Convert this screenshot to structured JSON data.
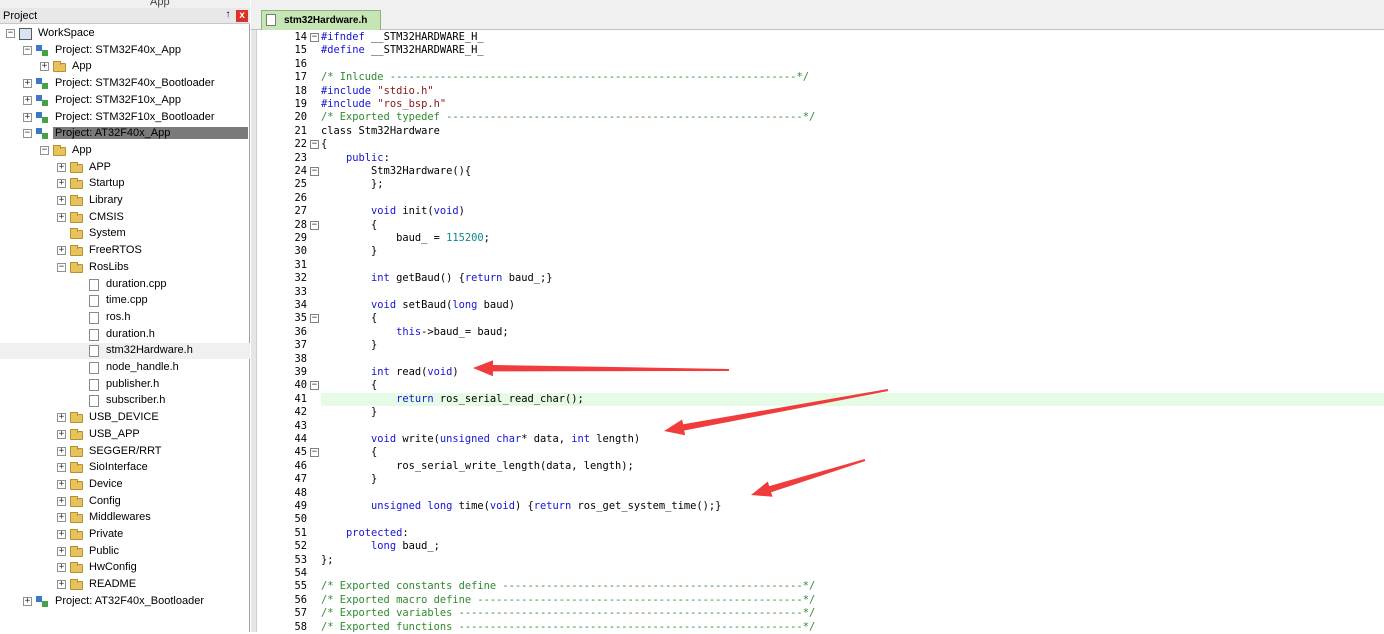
{
  "panel": {
    "title": "Project",
    "toolbar_text": "App",
    "pin_glyph": "↑",
    "close_glyph": "x"
  },
  "tree": [
    {
      "label": "WorkSpace",
      "level": 0,
      "icon": "workspace-icon",
      "exp": "-"
    },
    {
      "label": "Project: STM32F40x_App",
      "level": 1,
      "icon": "project-icon",
      "exp": "-"
    },
    {
      "label": "App",
      "level": 2,
      "icon": "folder-icon",
      "exp": "+"
    },
    {
      "label": "Project: STM32F40x_Bootloader",
      "level": 1,
      "icon": "project-icon",
      "exp": "+"
    },
    {
      "label": "Project: STM32F10x_App",
      "level": 1,
      "icon": "project-icon",
      "exp": "+"
    },
    {
      "label": "Project: STM32F10x_Bootloader",
      "level": 1,
      "icon": "project-icon",
      "exp": "+"
    },
    {
      "label": "Project: AT32F40x_App",
      "level": 1,
      "icon": "project-icon",
      "exp": "-",
      "selected": true
    },
    {
      "label": "App",
      "level": 2,
      "icon": "folder-icon",
      "exp": "-"
    },
    {
      "label": "APP",
      "level": 3,
      "icon": "folder-icon",
      "exp": "+"
    },
    {
      "label": "Startup",
      "level": 3,
      "icon": "folder-icon",
      "exp": "+"
    },
    {
      "label": "Library",
      "level": 3,
      "icon": "folder-icon",
      "exp": "+"
    },
    {
      "label": "CMSIS",
      "level": 3,
      "icon": "folder-icon",
      "exp": "+"
    },
    {
      "label": "System",
      "level": 3,
      "icon": "folder-icon",
      "exp": ""
    },
    {
      "label": "FreeRTOS",
      "level": 3,
      "icon": "folder-icon",
      "exp": "+"
    },
    {
      "label": "RosLibs",
      "level": 3,
      "icon": "folder-icon",
      "exp": "-"
    },
    {
      "label": "duration.cpp",
      "level": 4,
      "icon": "file-icon",
      "exp": ""
    },
    {
      "label": "time.cpp",
      "level": 4,
      "icon": "file-icon",
      "exp": ""
    },
    {
      "label": "ros.h",
      "level": 4,
      "icon": "file-icon",
      "exp": ""
    },
    {
      "label": "duration.h",
      "level": 4,
      "icon": "file-icon",
      "exp": ""
    },
    {
      "label": "stm32Hardware.h",
      "level": 4,
      "icon": "file-icon",
      "exp": "",
      "hover": true
    },
    {
      "label": "node_handle.h",
      "level": 4,
      "icon": "file-icon",
      "exp": ""
    },
    {
      "label": "publisher.h",
      "level": 4,
      "icon": "file-icon",
      "exp": ""
    },
    {
      "label": "subscriber.h",
      "level": 4,
      "icon": "file-icon",
      "exp": ""
    },
    {
      "label": "USB_DEVICE",
      "level": 3,
      "icon": "folder-icon",
      "exp": "+"
    },
    {
      "label": "USB_APP",
      "level": 3,
      "icon": "folder-icon",
      "exp": "+"
    },
    {
      "label": "SEGGER/RRT",
      "level": 3,
      "icon": "folder-icon",
      "exp": "+"
    },
    {
      "label": "SioInterface",
      "level": 3,
      "icon": "folder-icon",
      "exp": "+"
    },
    {
      "label": "Device",
      "level": 3,
      "icon": "folder-icon",
      "exp": "+"
    },
    {
      "label": "Config",
      "level": 3,
      "icon": "folder-icon",
      "exp": "+"
    },
    {
      "label": "Middlewares",
      "level": 3,
      "icon": "folder-icon",
      "exp": "+"
    },
    {
      "label": "Private",
      "level": 3,
      "icon": "folder-icon",
      "exp": "+"
    },
    {
      "label": "Public",
      "level": 3,
      "icon": "folder-icon",
      "exp": "+"
    },
    {
      "label": "HwConfig",
      "level": 3,
      "icon": "folder-icon",
      "exp": "+"
    },
    {
      "label": "README",
      "level": 3,
      "icon": "folder-icon",
      "exp": "+"
    },
    {
      "label": "Project: AT32F40x_Bootloader",
      "level": 1,
      "icon": "project-icon",
      "exp": "+"
    }
  ],
  "editor": {
    "tab_label": "stm32Hardware.h",
    "highlight_line": 41,
    "lines": [
      {
        "n": "14",
        "fold": "-",
        "seg": [
          [
            "pp",
            "#ifndef"
          ],
          [
            "tx",
            " __STM32HARDWARE_H_"
          ]
        ]
      },
      {
        "n": "15",
        "fold": "",
        "seg": [
          [
            "pp",
            "#define"
          ],
          [
            "tx",
            " __STM32HARDWARE_H_"
          ]
        ]
      },
      {
        "n": "16",
        "fold": "",
        "seg": []
      },
      {
        "n": "17",
        "fold": "",
        "seg": [
          [
            "cm",
            "/* Inlcude -----------------------------------------------------------------*/"
          ]
        ]
      },
      {
        "n": "18",
        "fold": "",
        "seg": [
          [
            "pp",
            "#include"
          ],
          [
            "tx",
            " "
          ],
          [
            "str",
            "\"stdio.h\""
          ]
        ]
      },
      {
        "n": "19",
        "fold": "",
        "seg": [
          [
            "pp",
            "#include"
          ],
          [
            "tx",
            " "
          ],
          [
            "str",
            "\"ros_bsp.h\""
          ]
        ]
      },
      {
        "n": "20",
        "fold": "",
        "seg": [
          [
            "cm",
            "/* Exported typedef ---------------------------------------------------------*/"
          ]
        ]
      },
      {
        "n": "21",
        "fold": "",
        "seg": [
          [
            "tx",
            "class Stm32Hardware"
          ]
        ]
      },
      {
        "n": "22",
        "fold": "-",
        "seg": [
          [
            "tx",
            "{"
          ]
        ]
      },
      {
        "n": "23",
        "fold": "",
        "seg": [
          [
            "tx",
            "    "
          ],
          [
            "kw",
            "public"
          ],
          [
            "tx",
            ":"
          ]
        ]
      },
      {
        "n": "24",
        "fold": "-",
        "seg": [
          [
            "tx",
            "        Stm32Hardware(){"
          ]
        ]
      },
      {
        "n": "25",
        "fold": "",
        "seg": [
          [
            "tx",
            "        };"
          ]
        ]
      },
      {
        "n": "26",
        "fold": "",
        "seg": []
      },
      {
        "n": "27",
        "fold": "",
        "seg": [
          [
            "tx",
            "        "
          ],
          [
            "kw",
            "void"
          ],
          [
            "tx",
            " init("
          ],
          [
            "kw",
            "void"
          ],
          [
            "tx",
            ")"
          ]
        ]
      },
      {
        "n": "28",
        "fold": "-",
        "seg": [
          [
            "tx",
            "        {"
          ]
        ]
      },
      {
        "n": "29",
        "fold": "",
        "seg": [
          [
            "tx",
            "            baud_ = "
          ],
          [
            "num",
            "115200"
          ],
          [
            "tx",
            ";"
          ]
        ]
      },
      {
        "n": "30",
        "fold": "",
        "seg": [
          [
            "tx",
            "        }"
          ]
        ]
      },
      {
        "n": "31",
        "fold": "",
        "seg": []
      },
      {
        "n": "32",
        "fold": "",
        "seg": [
          [
            "tx",
            "        "
          ],
          [
            "kw",
            "int"
          ],
          [
            "tx",
            " getBaud() {"
          ],
          [
            "kw",
            "return"
          ],
          [
            "tx",
            " baud_;}"
          ]
        ]
      },
      {
        "n": "33",
        "fold": "",
        "seg": []
      },
      {
        "n": "34",
        "fold": "",
        "seg": [
          [
            "tx",
            "        "
          ],
          [
            "kw",
            "void"
          ],
          [
            "tx",
            " setBaud("
          ],
          [
            "kw",
            "long"
          ],
          [
            "tx",
            " baud)"
          ]
        ]
      },
      {
        "n": "35",
        "fold": "-",
        "seg": [
          [
            "tx",
            "        {"
          ]
        ]
      },
      {
        "n": "36",
        "fold": "",
        "seg": [
          [
            "tx",
            "            "
          ],
          [
            "kw",
            "this"
          ],
          [
            "tx",
            "->baud_= baud;"
          ]
        ]
      },
      {
        "n": "37",
        "fold": "",
        "seg": [
          [
            "tx",
            "        }"
          ]
        ]
      },
      {
        "n": "38",
        "fold": "",
        "seg": []
      },
      {
        "n": "39",
        "fold": "",
        "seg": [
          [
            "tx",
            "        "
          ],
          [
            "kw",
            "int"
          ],
          [
            "tx",
            " read("
          ],
          [
            "kw",
            "void"
          ],
          [
            "tx",
            ")"
          ]
        ]
      },
      {
        "n": "40",
        "fold": "-",
        "seg": [
          [
            "tx",
            "        {"
          ]
        ]
      },
      {
        "n": "41",
        "fold": "",
        "seg": [
          [
            "tx",
            "            "
          ],
          [
            "kw",
            "return"
          ],
          [
            "tx",
            " ros_serial_read_char();"
          ]
        ]
      },
      {
        "n": "42",
        "fold": "",
        "seg": [
          [
            "tx",
            "        }"
          ]
        ]
      },
      {
        "n": "43",
        "fold": "",
        "seg": []
      },
      {
        "n": "44",
        "fold": "",
        "seg": [
          [
            "tx",
            "        "
          ],
          [
            "kw",
            "void"
          ],
          [
            "tx",
            " write("
          ],
          [
            "kw",
            "unsigned char"
          ],
          [
            "tx",
            "* data, "
          ],
          [
            "kw",
            "int"
          ],
          [
            "tx",
            " length)"
          ]
        ]
      },
      {
        "n": "45",
        "fold": "-",
        "seg": [
          [
            "tx",
            "        {"
          ]
        ]
      },
      {
        "n": "46",
        "fold": "",
        "seg": [
          [
            "tx",
            "            ros_serial_write_length(data, length);"
          ]
        ]
      },
      {
        "n": "47",
        "fold": "",
        "seg": [
          [
            "tx",
            "        }"
          ]
        ]
      },
      {
        "n": "48",
        "fold": "",
        "seg": []
      },
      {
        "n": "49",
        "fold": "",
        "seg": [
          [
            "tx",
            "        "
          ],
          [
            "kw",
            "unsigned long"
          ],
          [
            "tx",
            " time("
          ],
          [
            "kw",
            "void"
          ],
          [
            "tx",
            ") {"
          ],
          [
            "kw",
            "return"
          ],
          [
            "tx",
            " ros_get_system_time();}"
          ]
        ]
      },
      {
        "n": "50",
        "fold": "",
        "seg": []
      },
      {
        "n": "51",
        "fold": "",
        "seg": [
          [
            "tx",
            "    "
          ],
          [
            "kw",
            "protected"
          ],
          [
            "tx",
            ":"
          ]
        ]
      },
      {
        "n": "52",
        "fold": "",
        "seg": [
          [
            "tx",
            "        "
          ],
          [
            "kw",
            "long"
          ],
          [
            "tx",
            " baud_;"
          ]
        ]
      },
      {
        "n": "53",
        "fold": "",
        "seg": [
          [
            "tx",
            "};"
          ]
        ]
      },
      {
        "n": "54",
        "fold": "",
        "seg": []
      },
      {
        "n": "55",
        "fold": "",
        "seg": [
          [
            "cm",
            "/* Exported constants define ------------------------------------------------*/"
          ]
        ]
      },
      {
        "n": "56",
        "fold": "",
        "seg": [
          [
            "cm",
            "/* Exported macro define ----------------------------------------------------*/"
          ]
        ]
      },
      {
        "n": "57",
        "fold": "",
        "seg": [
          [
            "cm",
            "/* Exported variables -------------------------------------------------------*/"
          ]
        ]
      },
      {
        "n": "58",
        "fold": "",
        "seg": [
          [
            "cm",
            "/* Exported functions -------------------------------------------------------*/"
          ]
        ]
      }
    ]
  },
  "colors": {
    "arrow": "#f03c3c",
    "highlight": "#e6fbe6",
    "tab_bg": "#c6e5b5"
  }
}
